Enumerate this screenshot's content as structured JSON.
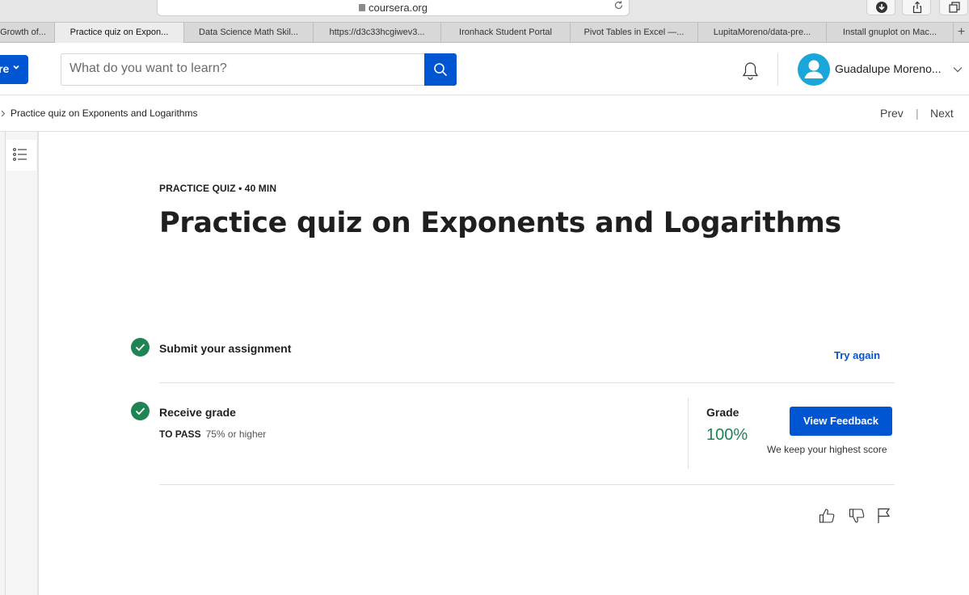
{
  "browser": {
    "url": "coursera.org",
    "tabs": [
      {
        "label": "Growth of..."
      },
      {
        "label": "Practice quiz on Expon...",
        "active": true
      },
      {
        "label": "Data Science Math Skil..."
      },
      {
        "label": "https://d3c33hcgiwev3..."
      },
      {
        "label": "Ironhack Student Portal"
      },
      {
        "label": "Pivot Tables in Excel —..."
      },
      {
        "label": "LupitaMoreno/data-pre..."
      },
      {
        "label": "Install gnuplot on Mac..."
      }
    ],
    "new_tab_label": "+"
  },
  "header": {
    "explore_label": "re",
    "search_placeholder": "What do you want to learn?",
    "user_name": "Guadalupe Moreno..."
  },
  "breadcrumb": {
    "current": "Practice quiz on Exponents and Logarithms",
    "prev_label": "Prev",
    "separator": "|",
    "next_label": "Next"
  },
  "quiz": {
    "eyebrow": "PRACTICE QUIZ • 40 MIN",
    "title": "Practice quiz on Exponents and Logarithms",
    "submit_step": {
      "title": "Submit your assignment",
      "action_label": "Try again"
    },
    "grade_step": {
      "title": "Receive grade",
      "to_pass_label": "TO PASS",
      "to_pass_value": "75% or higher",
      "grade_label": "Grade",
      "grade_value": "100%",
      "button_label": "View Feedback",
      "note": "We keep your highest score"
    }
  },
  "colors": {
    "brand_blue": "#0056d2",
    "success_green": "#1f8354",
    "avatar_blue": "#1ba6d9"
  },
  "icons": [
    "lock-icon",
    "reload-icon",
    "download-icon",
    "share-icon",
    "tabs-overview-icon",
    "chevron-down-icon",
    "search-icon",
    "bell-icon",
    "user-icon",
    "chevron-right-icon",
    "list-icon",
    "check-icon",
    "thumbs-up-icon",
    "thumbs-down-icon",
    "flag-icon"
  ]
}
